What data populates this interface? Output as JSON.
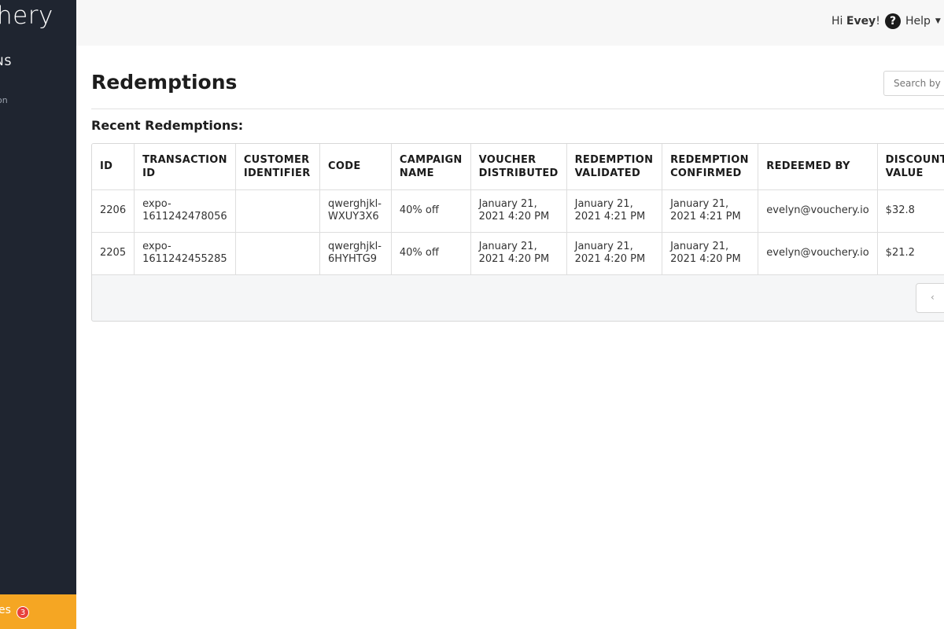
{
  "sidebar": {
    "logo": "hery",
    "section_label": "NS",
    "sub_label": "on",
    "footer_label": "es",
    "footer_badge": "3"
  },
  "topbar": {
    "greeting_prefix": "Hi ",
    "user_name": "Evey",
    "greeting_suffix": "!",
    "help_label": "Help"
  },
  "page": {
    "title": "Redemptions",
    "search_placeholder": "Search by code",
    "subtitle": "Recent Redemptions:"
  },
  "table": {
    "columns": [
      "ID",
      "TRANSACTION ID",
      "CUSTOMER IDENTIFIER",
      "CODE",
      "CAMPAIGN NAME",
      "VOUCHER DISTRIBUTED",
      "REDEMPTION VALIDATED",
      "REDEMPTION CONFIRMED",
      "REDEEMED BY",
      "DISCOUNT VALUE"
    ],
    "rows": [
      [
        "2206",
        "expo-1611242478056",
        "",
        "qwerghjkl-WXUY3X6",
        "40% off",
        "January 21, 2021 4:20 PM",
        "January 21, 2021 4:21 PM",
        "January 21, 2021 4:21 PM",
        "evelyn@vouchery.io",
        "$32.8"
      ],
      [
        "2205",
        "expo-1611242455285",
        "",
        "qwerghjkl-6HYHTG9",
        "40% off",
        "January 21, 2021 4:20 PM",
        "January 21, 2021 4:20 PM",
        "January 21, 2021 4:20 PM",
        "evelyn@vouchery.io",
        "$21.2"
      ]
    ],
    "pager_prev": "‹"
  },
  "colors": {
    "sidebar_bg": "#1f2530",
    "accent": "#f5a623",
    "badge": "#e8413a"
  }
}
